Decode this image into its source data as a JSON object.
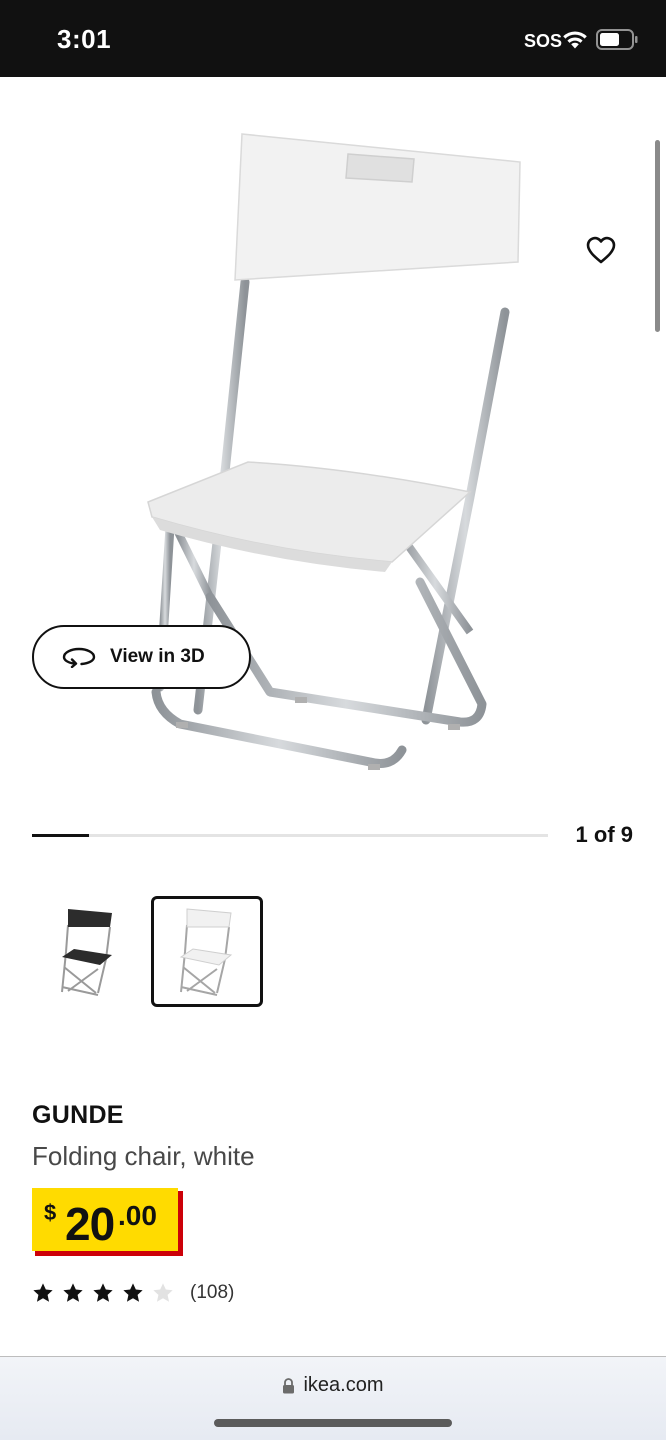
{
  "status_bar": {
    "time": "3:01",
    "sos": "SOS"
  },
  "product_image": {
    "view3d_label": "View in 3D",
    "page_counter": "1 of 9",
    "progress": 0.11
  },
  "thumbnails": [
    {
      "color": "black",
      "selected": false
    },
    {
      "color": "white",
      "selected": true
    }
  ],
  "product": {
    "name": "GUNDE",
    "description": "Folding chair, white",
    "price": {
      "currency": "$",
      "whole": "20",
      "decimal": ".00"
    },
    "rating": {
      "stars": 4,
      "max": 5,
      "review_count": "(108)"
    }
  },
  "browser": {
    "url": "ikea.com"
  },
  "colors": {
    "price_yellow": "#ffdb00",
    "price_red": "#cc0008",
    "status_bg": "#111111"
  },
  "icons": [
    "wifi-icon",
    "battery-icon",
    "heart-icon",
    "rotate-3d-icon",
    "star-icon",
    "lock-icon"
  ]
}
